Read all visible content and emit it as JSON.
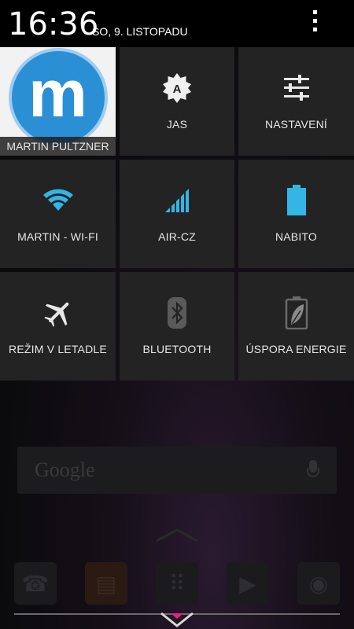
{
  "status_bar": {
    "time": "16:36",
    "date": "SO, 9. LISTOPADU"
  },
  "quick_settings": {
    "user": {
      "name": "MARTIN PULTZNER"
    },
    "brightness": {
      "label": "JAS",
      "icon": "auto-brightness-icon"
    },
    "settings": {
      "label": "NASTAVENÍ",
      "icon": "sliders-icon"
    },
    "wifi": {
      "label": "MARTIN - WI-FI",
      "icon": "wifi-icon"
    },
    "mobile": {
      "label": "AIR-CZ",
      "icon": "signal-icon"
    },
    "battery": {
      "label": "NABITO",
      "icon": "battery-icon"
    },
    "airplane": {
      "label": "REŽIM V LETADLE",
      "icon": "airplane-icon"
    },
    "bluetooth": {
      "label": "BLUETOOTH",
      "icon": "bluetooth-icon"
    },
    "power_saver": {
      "label": "ÚSPORA ENERGIE",
      "icon": "leaf-battery-icon"
    }
  },
  "home": {
    "search_text": "Google"
  },
  "colors": {
    "accent_blue": "#33b5e5",
    "tile_bg": "#232323",
    "handle_pink": "#e0247e"
  }
}
